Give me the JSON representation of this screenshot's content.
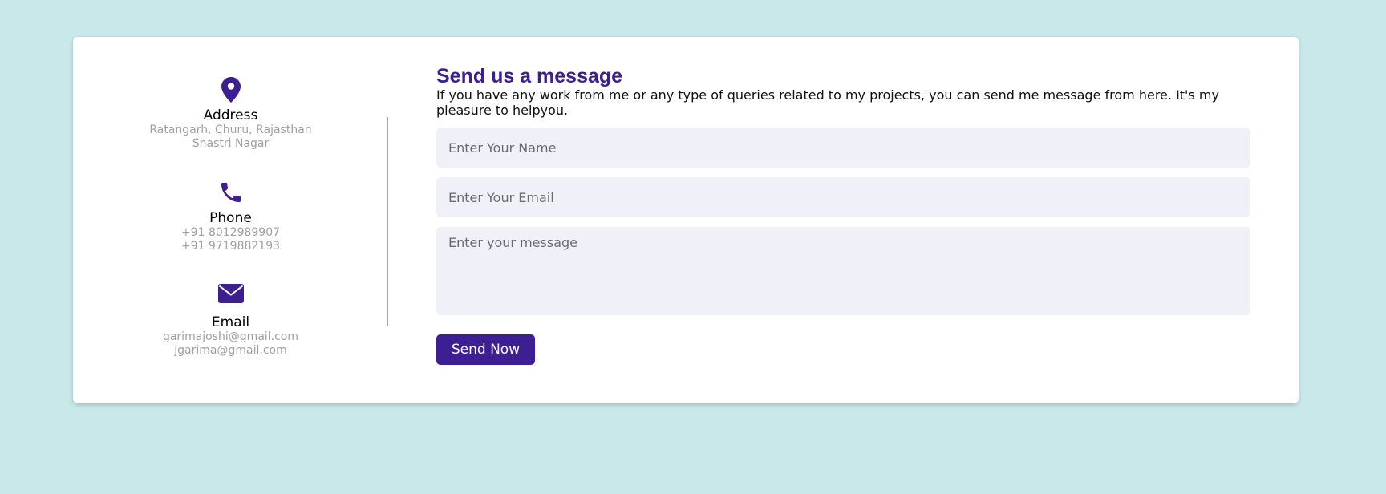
{
  "contact_info": {
    "address": {
      "icon": "map-pin-icon",
      "label": "Address",
      "line1": "Ratangarh, Churu, Rajasthan",
      "line2": "Shastri Nagar"
    },
    "phone": {
      "icon": "phone-icon",
      "label": "Phone",
      "line1": "+91 8012989907",
      "line2": "+91 9719882193"
    },
    "email": {
      "icon": "envelope-icon",
      "label": "Email",
      "line1": "garimajoshi@gmail.com",
      "line2": "jgarima@gmail.com"
    }
  },
  "form": {
    "title": "Send us a message",
    "description": "If you have any work from me or any type of queries related to my projects, you can send me message from here. It's my pleasure to helpyou.",
    "name_placeholder": "Enter Your Name",
    "email_placeholder": "Enter Your Email",
    "message_placeholder": "Enter your message",
    "submit_label": "Send Now"
  },
  "colors": {
    "background": "#c8e8ea",
    "accent": "#3e1f92",
    "input_bg": "#eff0f8"
  }
}
